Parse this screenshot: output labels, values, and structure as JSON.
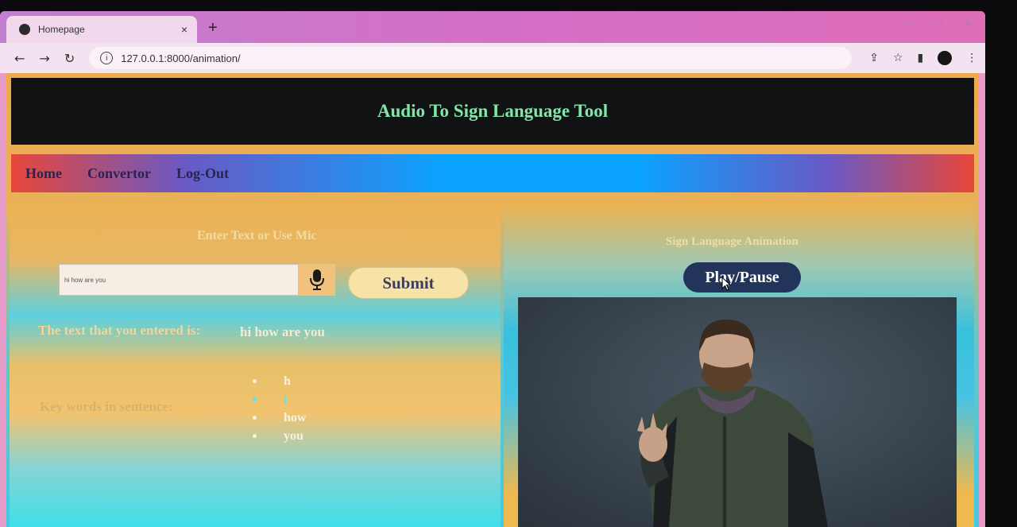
{
  "browser": {
    "tab_title": "Homepage",
    "tab_close": "×",
    "new_tab": "+",
    "url": "127.0.0.1:8000/animation/"
  },
  "header": {
    "title": "Audio To Sign Language Tool"
  },
  "nav": {
    "items": [
      "Home",
      "Convertor",
      "Log-Out"
    ]
  },
  "input_section": {
    "title": "Enter Text or Use Mic",
    "text_value": "hi how are you",
    "submit_label": "Submit",
    "entered_label": "The text that you entered is:",
    "entered_value": "hi how are you",
    "keywords_label": "Key words in sentence:",
    "keywords": [
      "h",
      "i",
      "how",
      "you"
    ]
  },
  "animation_section": {
    "title": "Sign Language Animation",
    "play_label": "Play/Pause"
  },
  "colors": {
    "header_bg": "#111214",
    "title_green": "#7fe8a6",
    "nav_text": "#2b2450",
    "play_button": "#23345a"
  }
}
